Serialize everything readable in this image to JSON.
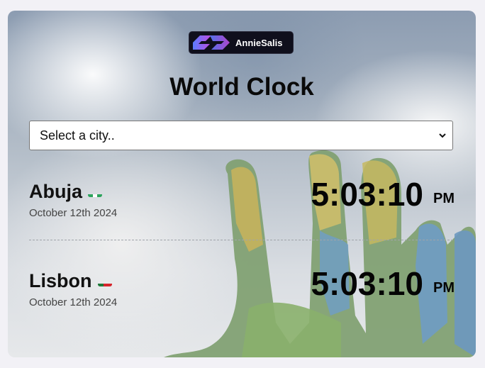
{
  "brand": {
    "name": "AnnieSalis"
  },
  "page": {
    "title": "World Clock"
  },
  "city_select": {
    "selected": "Select a city.."
  },
  "cities": [
    {
      "name": "Abuja",
      "flag": "nigeria-flag",
      "date": "October 12th 2024",
      "time": "5:03:10",
      "ampm": "PM"
    },
    {
      "name": "Lisbon",
      "flag": "portugal-flag",
      "date": "October 12th 2024",
      "time": "5:03:10",
      "ampm": "PM"
    }
  ],
  "colors": {
    "accent_gradient_start": "#5a7cff",
    "accent_gradient_end": "#c04be0"
  }
}
